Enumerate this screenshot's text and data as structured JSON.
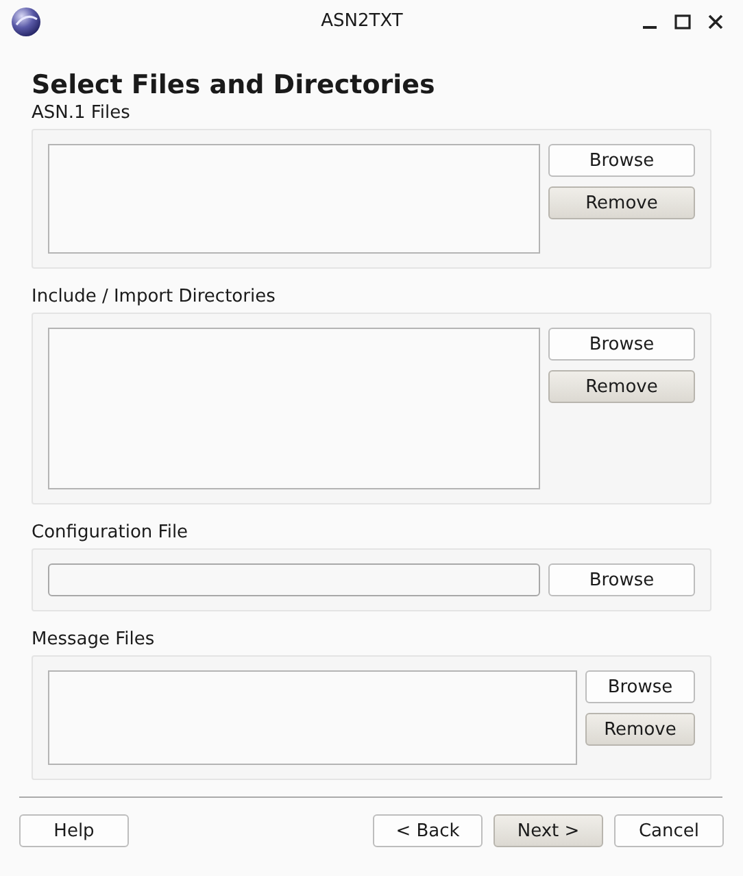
{
  "window": {
    "title": "ASN2TXT"
  },
  "heading": "Select Files and Directories",
  "sections": [
    {
      "label": "ASN.1 Files",
      "kind": "list",
      "buttons": [
        {
          "label": "Browse",
          "shaded": false
        },
        {
          "label": "Remove",
          "shaded": true
        }
      ]
    },
    {
      "label": "Include / Import Directories",
      "kind": "list",
      "buttons": [
        {
          "label": "Browse",
          "shaded": false
        },
        {
          "label": "Remove",
          "shaded": true
        }
      ]
    },
    {
      "label": "Configuration File",
      "kind": "field",
      "buttons": [
        {
          "label": "Browse",
          "shaded": false
        }
      ]
    },
    {
      "label": "Message Files",
      "kind": "list",
      "buttons": [
        {
          "label": "Browse",
          "shaded": false
        },
        {
          "label": "Remove",
          "shaded": true
        }
      ]
    }
  ],
  "footer": {
    "left": [
      {
        "label": "Help",
        "shaded": false
      }
    ],
    "right": [
      {
        "label": "< Back",
        "shaded": false
      },
      {
        "label": "Next >",
        "shaded": true
      },
      {
        "label": "Cancel",
        "shaded": false
      }
    ]
  }
}
